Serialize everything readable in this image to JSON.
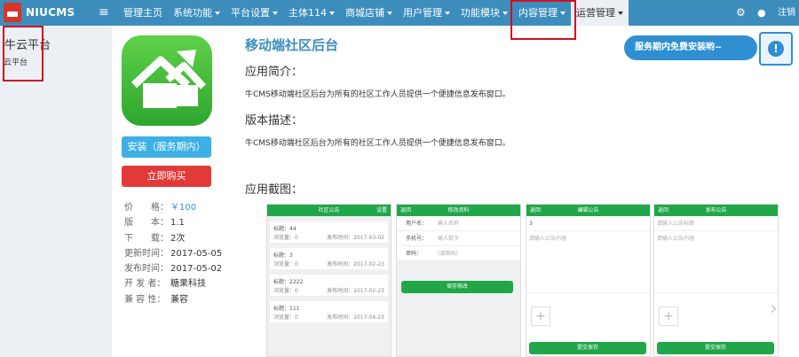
{
  "nav": {
    "brand": "NIUCMS",
    "menu": [
      {
        "label": "管理主页",
        "caret": false
      },
      {
        "label": "系统功能",
        "caret": true
      },
      {
        "label": "平台设置",
        "caret": true
      },
      {
        "label": "主体114",
        "caret": true
      },
      {
        "label": "商城店铺",
        "caret": true
      },
      {
        "label": "用户管理",
        "caret": true
      },
      {
        "label": "功能模块",
        "caret": true
      },
      {
        "label": "内容管理",
        "caret": true
      },
      {
        "label": "运营管理",
        "caret": true,
        "active": true
      }
    ],
    "gear_icon": "gear-icon",
    "drop_icon": "tint-icon",
    "logout": "注销"
  },
  "sidebar": {
    "title": "牛云平台",
    "subtitle": "云平台"
  },
  "app": {
    "title": "移动端社区后台",
    "intro_heading": "应用简介：",
    "intro_text": "牛CMS移动端社区后台为所有的社区工作人员提供一个便捷信息发布窗口。",
    "version_heading": "版本描述：",
    "version_text": "牛CMS移动端社区后台为所有的社区工作人员提供一个便捷信息发布窗口。",
    "screens_heading": "应用截图：",
    "install_button": "安装（服务期内）",
    "buy_button": "立即购买",
    "info": [
      {
        "key": "价　　格：",
        "value": "￥100"
      },
      {
        "key": "版　　本：",
        "value": "1.1"
      },
      {
        "key": "下　　载：",
        "value": "2次"
      },
      {
        "key": "更新时间：",
        "value": "2017-05-05"
      },
      {
        "key": "发布时间：",
        "value": "2017-05-02"
      },
      {
        "key": "开 发 者：",
        "value": "糖果科技"
      },
      {
        "key": "兼 容 性：",
        "value": "兼容"
      }
    ]
  },
  "banner": {
    "text": "服务期内免费安装哟~"
  },
  "screens": {
    "s1": {
      "title": "社区公告",
      "right": "设置",
      "items": [
        {
          "title": "标题：44",
          "browse": "浏览量：0",
          "date": "发布时间：2017-03-02"
        },
        {
          "title": "标题：3",
          "browse": "浏览量：0",
          "date": "发布时间：2017-02-23"
        },
        {
          "title": "标题：2222",
          "browse": "浏览量：0",
          "date": "发布时间：2017-02-23"
        },
        {
          "title": "标题：111",
          "browse": "浏览量：0",
          "date": "发布时间：2017-04-23"
        }
      ]
    },
    "s2": {
      "back": "返回",
      "title": "修改资料",
      "rows": [
        {
          "label": "用户名：",
          "ph": "输入名称"
        },
        {
          "label": "手机号：",
          "ph": "输入数字"
        },
        {
          "label": "密码：",
          "ph": "(减密码)"
        }
      ],
      "button": "保存修改"
    },
    "s3": {
      "back": "返回",
      "title": "编辑公告",
      "field1": "3",
      "field2": "请输入公告内容",
      "button": "提交保存"
    },
    "s4": {
      "back": "返回",
      "title": "发布公告",
      "field1": "请输入公告标题",
      "field2": "请输入公告内容",
      "button": "提交保存"
    }
  }
}
